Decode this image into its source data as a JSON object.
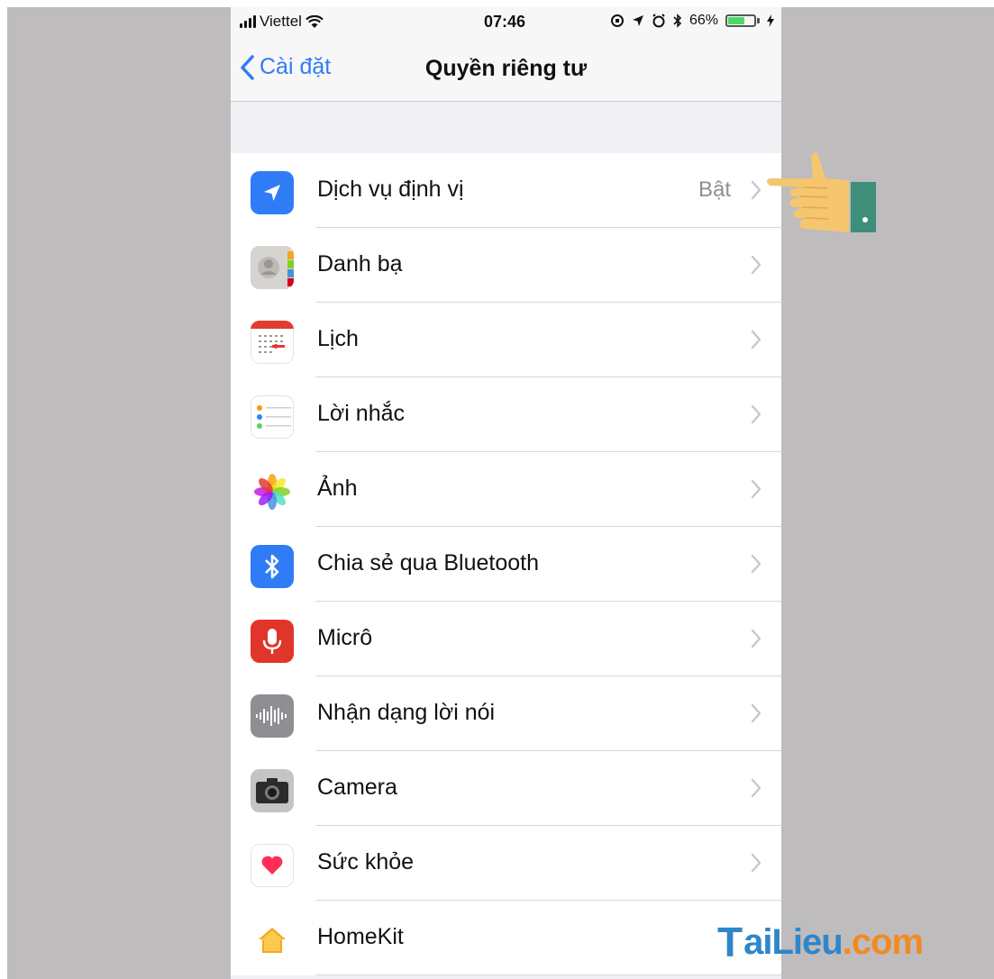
{
  "status_bar": {
    "carrier": "Viettel",
    "time": "07:46",
    "battery": "66%",
    "battery_level": 0.66,
    "icons": [
      "signal-icon",
      "wifi-icon",
      "rotation-lock-icon",
      "location-icon",
      "alarm-icon",
      "bluetooth-icon",
      "charging-icon"
    ]
  },
  "nav": {
    "back_label": "Cài đặt",
    "title": "Quyền riêng tư"
  },
  "rows": [
    {
      "label": "Dịch vụ định vị",
      "value": "Bật",
      "icon": "location-icon",
      "color": "#2f7cf6"
    },
    {
      "label": "Danh bạ",
      "value": "",
      "icon": "contacts-icon",
      "color": "#c9c8c6"
    },
    {
      "label": "Lịch",
      "value": "",
      "icon": "calendar-icon",
      "color": "#ffffff"
    },
    {
      "label": "Lời nhắc",
      "value": "",
      "icon": "reminders-icon",
      "color": "#ffffff"
    },
    {
      "label": "Ảnh",
      "value": "",
      "icon": "photos-icon",
      "color": "#ffffff"
    },
    {
      "label": "Chia sẻ qua Bluetooth",
      "value": "",
      "icon": "bluetooth-icon",
      "color": "#2f7cf6"
    },
    {
      "label": "Micrô",
      "value": "",
      "icon": "microphone-icon",
      "color": "#e0352b"
    },
    {
      "label": "Nhận dạng lời nói",
      "value": "",
      "icon": "speech-recognition-icon",
      "color": "#8e8e93"
    },
    {
      "label": "Camera",
      "value": "",
      "icon": "camera-icon",
      "color": "#bdbdbd"
    },
    {
      "label": "Sức khỏe",
      "value": "",
      "icon": "health-icon",
      "color": "#ffffff"
    },
    {
      "label": "HomeKit",
      "value": "",
      "icon": "homekit-icon",
      "color": "#ffffff"
    }
  ],
  "watermark": {
    "t": "T",
    "brand": "aiLieu",
    "domain": ".com"
  }
}
